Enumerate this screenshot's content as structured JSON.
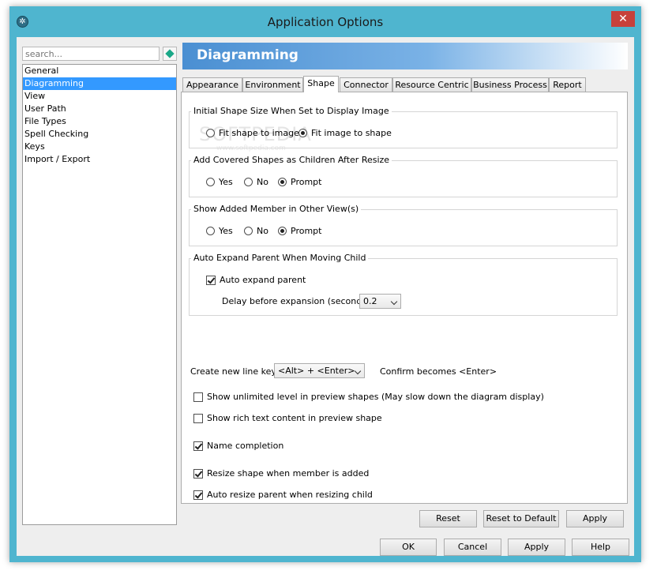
{
  "window": {
    "title": "Application Options",
    "close_glyph": "✕"
  },
  "search": {
    "placeholder": "search..."
  },
  "nav": {
    "items": [
      "General",
      "Diagramming",
      "View",
      "User Path",
      "File Types",
      "Spell Checking",
      "Keys",
      "Import / Export"
    ],
    "selected": "Diagramming"
  },
  "banner": {
    "title": "Diagramming"
  },
  "tabs": [
    "Appearance",
    "Environment",
    "Shape",
    "Connector",
    "Resource Centric",
    "Business Process",
    "Report"
  ],
  "active_tab": "Shape",
  "watermark": {
    "main": "SOFTPEDIA",
    "small": "www.softpedia.com"
  },
  "groups": {
    "initial_shape": {
      "title": "Initial Shape Size When Set to Display Image",
      "options": [
        "Fit shape to image",
        "Fit image to shape"
      ],
      "selected": "Fit image to shape"
    },
    "covered_shapes": {
      "title": "Add Covered Shapes as Children After Resize",
      "options": [
        "Yes",
        "No",
        "Prompt"
      ],
      "selected": "Prompt"
    },
    "added_member": {
      "title": "Show Added Member in Other View(s)",
      "options": [
        "Yes",
        "No",
        "Prompt"
      ],
      "selected": "Prompt"
    },
    "auto_expand": {
      "title": "Auto Expand Parent When Moving Child",
      "checkbox_label": "Auto expand parent",
      "checkbox_checked": true,
      "delay_label": "Delay before expansion (seconds) :",
      "delay_value": "0.2"
    }
  },
  "line_key": {
    "label": "Create new line key :",
    "value": "<Alt> + <Enter>",
    "confirm_text": "Confirm becomes <Enter>"
  },
  "checkboxes": [
    {
      "label": "Show unlimited level in preview shapes (May slow down the diagram display)",
      "checked": false
    },
    {
      "label": "Show rich text content in preview shape",
      "checked": false
    },
    {
      "label": "Name completion",
      "checked": true
    },
    {
      "label": "Resize shape when member is added",
      "checked": true
    },
    {
      "label": "Auto resize parent when resizing child",
      "checked": true
    }
  ],
  "panel_buttons": {
    "reset": "Reset",
    "reset_default": "Reset to Default",
    "apply": "Apply"
  },
  "dialog_buttons": {
    "ok": "OK",
    "cancel": "Cancel",
    "apply": "Apply",
    "help": "Help"
  },
  "colors": {
    "frame": "#4fb5cf",
    "selection": "#3399ff",
    "banner_start": "#4a8fd2",
    "close": "#c7413b"
  }
}
